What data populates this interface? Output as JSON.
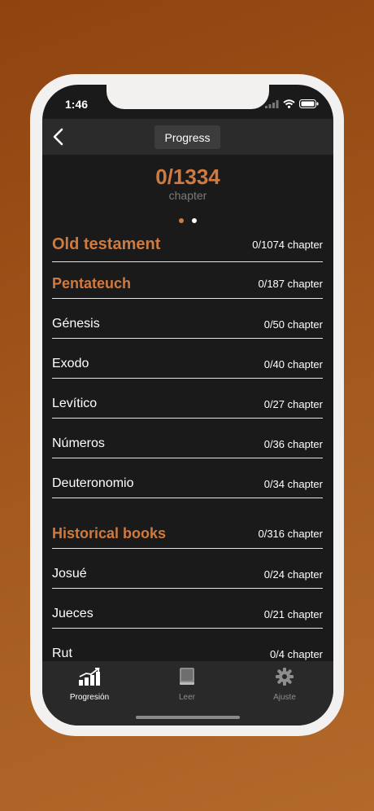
{
  "status": {
    "time": "1:46"
  },
  "nav": {
    "title": "Progress"
  },
  "summary": {
    "count": "0/1334",
    "unit": "chapter"
  },
  "pager": {
    "active_index": 0,
    "total": 2
  },
  "testament": {
    "name": "Old testament",
    "progress": "0/1074 chapter"
  },
  "sections": [
    {
      "name": "Pentateuch",
      "progress": "0/187 chapter",
      "books": [
        {
          "name": "Génesis",
          "progress": "0/50 chapter"
        },
        {
          "name": "Exodo",
          "progress": "0/40 chapter"
        },
        {
          "name": "Levítico",
          "progress": "0/27 chapter"
        },
        {
          "name": "Números",
          "progress": "0/36 chapter"
        },
        {
          "name": "Deuteronomio",
          "progress": "0/34 chapter"
        }
      ]
    },
    {
      "name": "Historical books",
      "progress": "0/316 chapter",
      "books": [
        {
          "name": "Josué",
          "progress": "0/24 chapter"
        },
        {
          "name": "Jueces",
          "progress": "0/21 chapter"
        },
        {
          "name": "Rut",
          "progress": "0/4 chapter"
        }
      ]
    }
  ],
  "tabs": [
    {
      "label": "Progresión",
      "icon": "chart-icon",
      "active": true
    },
    {
      "label": "Leer",
      "icon": "book-icon",
      "active": false
    },
    {
      "label": "Ajuste",
      "icon": "gear-icon",
      "active": false
    }
  ],
  "colors": {
    "accent": "#d07a3e",
    "background": "#1b1a1b",
    "navbar": "#2c2b2c",
    "tab_inactive": "#8d8d8d"
  }
}
